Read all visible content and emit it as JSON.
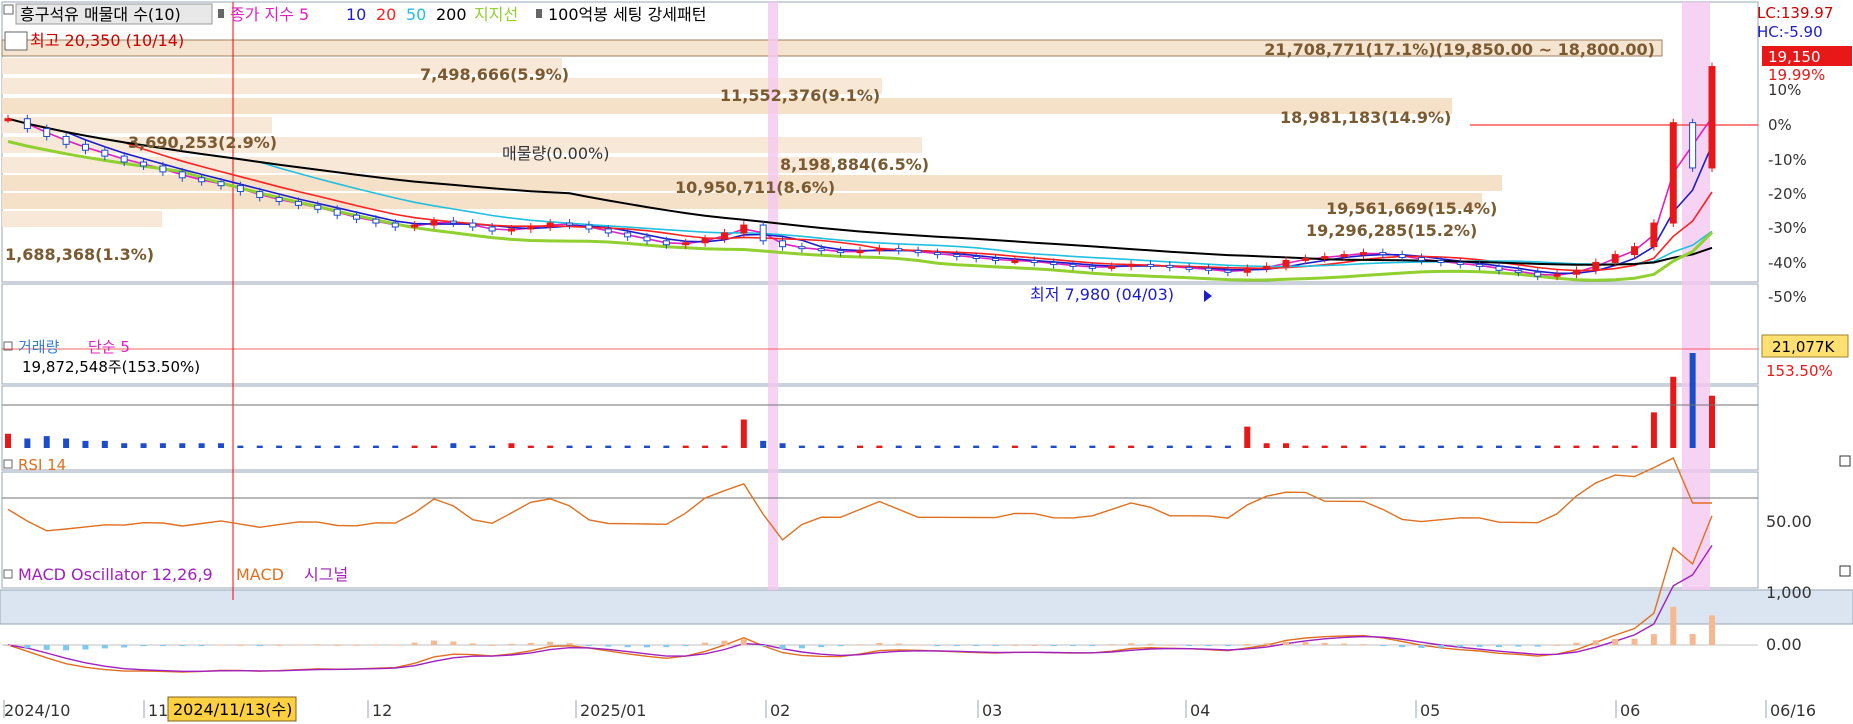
{
  "header": {
    "main_legend": [
      {
        "text": "흥구석유 매물대 수(10)",
        "color": "#000000",
        "boxed": true
      },
      {
        "text": "종가 지수 5",
        "color": "#e020c0"
      },
      {
        "text": "10",
        "color": "#1c1ccc"
      },
      {
        "text": "20",
        "color": "#ff2020"
      },
      {
        "text": "50",
        "color": "#20c0e0"
      },
      {
        "text": "200",
        "color": "#000000"
      },
      {
        "text": "지지선",
        "color": "#90d030"
      },
      {
        "text": "100억봉 세팅 강세패턴",
        "color": "#000000"
      }
    ],
    "volume_legend": [
      {
        "text": "거래량",
        "color": "#3a7fd0"
      },
      {
        "text": "단순 5",
        "color": "#e020c0"
      }
    ],
    "rsi_legend": [
      {
        "text": "RSI 14",
        "color": "#e07020"
      }
    ],
    "macd_legend": [
      {
        "text": "MACD Oscillator 12,26,9",
        "color": "#a020c0"
      },
      {
        "text": "MACD",
        "color": "#e07020"
      },
      {
        "text": "시그널",
        "color": "#a020c0"
      }
    ]
  },
  "right_info": {
    "lc": "LC:139.97",
    "hc": "HC:-5.90",
    "price_badge": "19,150",
    "price_change": "19.99%",
    "volume_badge": "21,077K",
    "volume_change": "153.50%"
  },
  "chart_data": {
    "type": "candlestick",
    "y_axis_pct_ticks": [
      "10%",
      "0%",
      "-10%",
      "-20%",
      "-30%",
      "-40%",
      "-50%"
    ],
    "x_ticks": [
      "2024/10",
      "11",
      "12",
      "2025/01",
      "02",
      "03",
      "04",
      "05",
      "06",
      "06/16"
    ],
    "crosshair_label": "2024/11/13(수)",
    "annotations": {
      "high": "최고 20,350 (10/14)",
      "low": "최저 7,980 (04/03)",
      "volume_total": "19,872,548주(153.50%)"
    },
    "volume_profile_labels": [
      "21,708,771(17.1%)(19,850.00 ~ 18,800.00)",
      "7,498,666(5.9%)",
      "11,552,376(9.1%)",
      "18,981,183(14.9%)",
      "3,690,253(2.9%)",
      "매물량(0.00%)",
      "8,198,884(6.5%)",
      "10,950,711(8.6%)",
      "19,561,669(15.4%)",
      "19,296,285(15.2%)",
      "1,688,368(1.3%)"
    ],
    "price_series": [
      16500,
      16000,
      15600,
      15200,
      14900,
      14600,
      14300,
      14100,
      13800,
      13500,
      13300,
      13100,
      12800,
      12500,
      12300,
      12100,
      11900,
      11600,
      11400,
      11200,
      11000,
      11100,
      11300,
      11200,
      11000,
      10800,
      10900,
      11000,
      11200,
      11100,
      10900,
      10700,
      10500,
      10300,
      10100,
      10200,
      10400,
      10700,
      11100,
      10300,
      10000,
      9900,
      9800,
      9700,
      9800,
      9900,
      9800,
      9700,
      9600,
      9500,
      9400,
      9300,
      9300,
      9200,
      9100,
      9000,
      8950,
      9000,
      9100,
      9050,
      8950,
      8900,
      8800,
      8700,
      8900,
      9000,
      9300,
      9400,
      9500,
      9600,
      9700,
      9600,
      9450,
      9300,
      9200,
      9100,
      9000,
      8800,
      8700,
      8500,
      8600,
      8800,
      9200,
      9600,
      10000,
      11200,
      16300,
      14000,
      19150
    ],
    "volume_series": [
      6,
      4,
      5,
      4,
      3,
      3,
      2,
      2,
      2,
      2,
      2,
      2,
      1,
      1,
      1,
      1,
      1,
      1,
      1,
      1,
      1,
      1,
      1,
      2,
      1,
      1,
      2,
      1,
      1,
      1,
      1,
      1,
      1,
      1,
      1,
      1,
      1,
      1,
      12,
      3,
      2,
      1,
      1,
      1,
      1,
      1,
      1,
      1,
      1,
      1,
      1,
      1,
      1,
      1,
      1,
      1,
      1,
      1,
      1,
      1,
      1,
      1,
      1,
      1,
      9,
      2,
      2,
      1,
      1,
      1,
      1,
      1,
      1,
      1,
      1,
      1,
      1,
      1,
      1,
      1,
      1,
      1,
      1,
      1,
      1,
      15,
      30,
      40,
      22
    ],
    "rsi_ticks": [
      "50.00"
    ],
    "macd_ticks": [
      "1,000",
      "0.00"
    ]
  }
}
